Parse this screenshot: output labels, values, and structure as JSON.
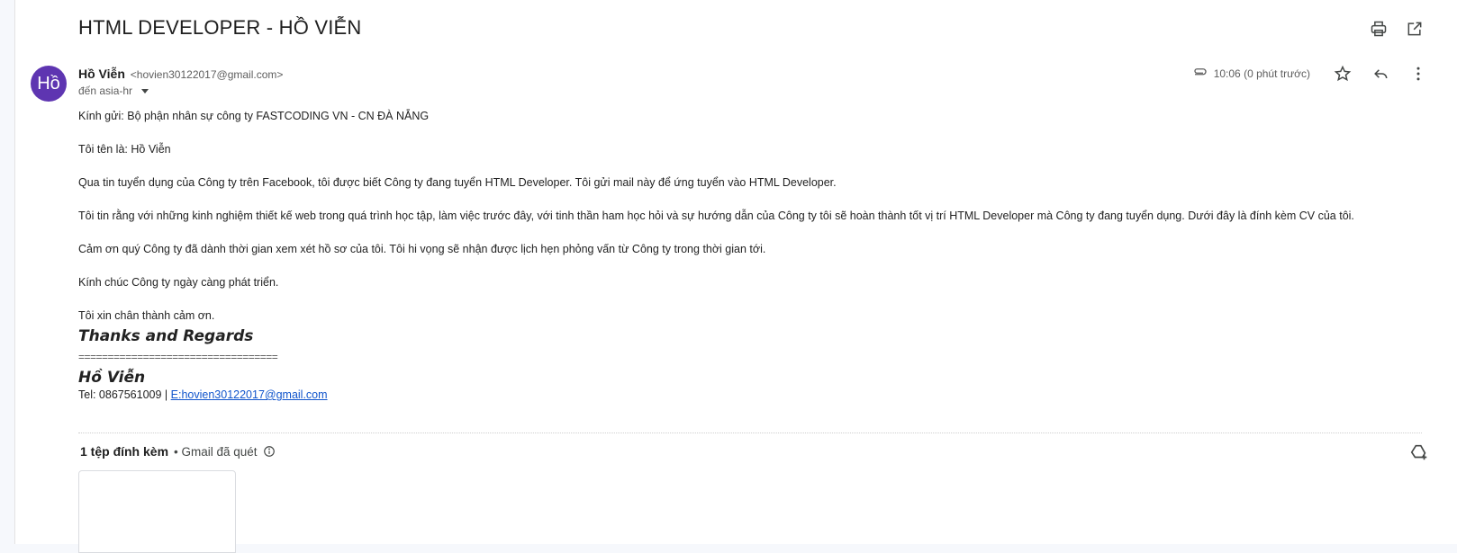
{
  "subject": "HTML DEVELOPER - HỒ VIỄN",
  "icons": {
    "print": "print-icon",
    "open_new_window": "open-in-new-window-icon",
    "attachment": "paperclip-icon",
    "star": "star-icon",
    "reply": "reply-icon",
    "more": "more-vert-icon",
    "info": "info-icon",
    "add_to_drive": "add-to-drive-icon"
  },
  "sender": {
    "avatar_text": "Hồ",
    "avatar_color": "#5e35b1",
    "name": "Hồ Viễn",
    "email": "<hovien30122017@gmail.com>",
    "recipient": "đến asia-hr",
    "time": "10:06 (0 phút trước)"
  },
  "body": {
    "greeting": "Kính gửi: Bộ phận nhân sự công ty FASTCODING VN - CN ĐÀ NẴNG",
    "intro": "Tôi tên là: Hồ Viễn",
    "p1": "Qua tin tuyển dụng của Công ty trên Facebook, tôi được biết Công ty đang tuyển HTML Developer. Tôi gửi mail này để ứng tuyển vào  HTML Developer.",
    "p2": "Tôi tin rằng với những kinh nghiệm thiết kế web trong quá trình học tập, làm việc trước đây, với tinh thần ham học hỏi và sự hướng dẫn của Công ty tôi sẽ hoàn thành tốt vị trí HTML Developer mà Công ty đang tuyển dụng. Dưới đây là đính kèm CV của tôi.",
    "p3": "Cảm ơn quý Công ty đã dành thời gian xem xét hồ sơ của tôi. Tôi hi vọng sẽ nhận được lịch hẹn phỏng vấn từ Công ty trong thời gian tới.",
    "p4": "Kính chúc Công ty ngày càng phát triển.",
    "p5": "Tôi xin chân thành cảm ơn."
  },
  "signature": {
    "title": "Thanks and Regards",
    "separator": "==================================",
    "name": "Hồ Viễn",
    "tel": "Tel: 0867561009 | ",
    "email_link": "E:hovien30122017@gmail.com"
  },
  "attachments": {
    "count_label": "1 tệp đính kèm",
    "scan_label": "• Gmail đã quét"
  },
  "colors": {
    "link": "#1155cc",
    "background": "#f6f8fc"
  }
}
